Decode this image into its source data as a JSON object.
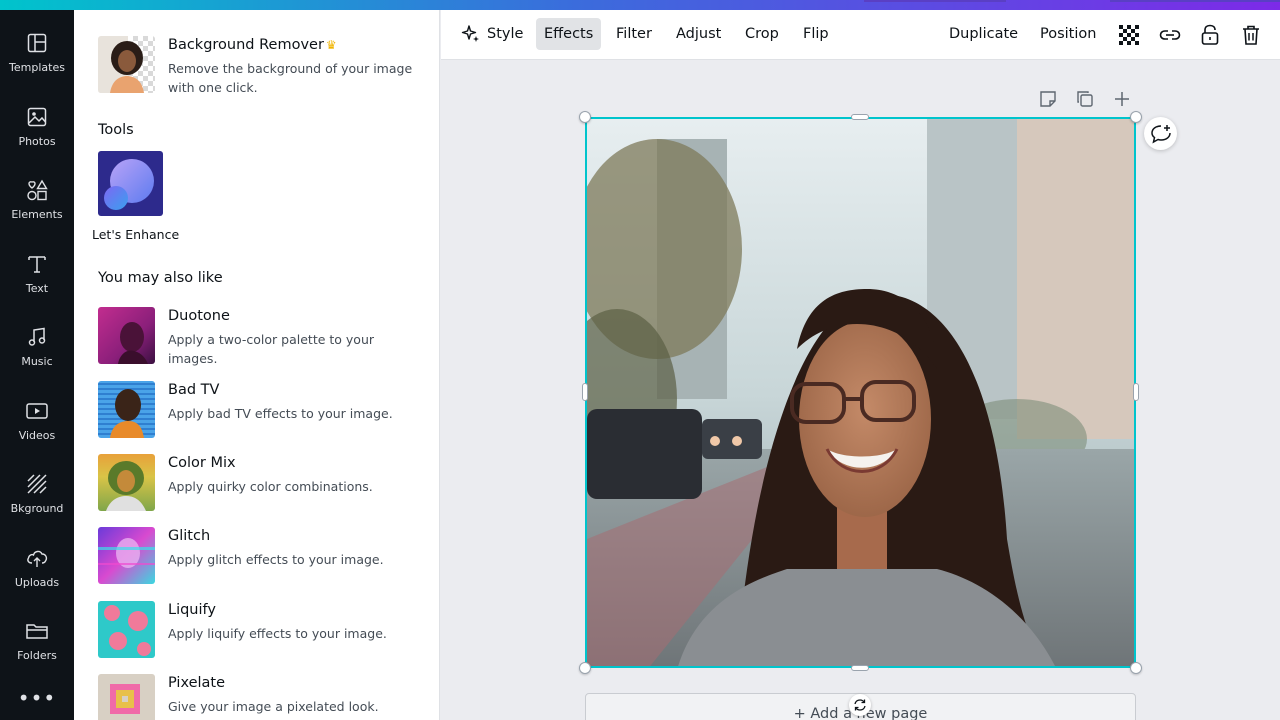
{
  "leftnav": {
    "items": [
      {
        "label": "Templates",
        "icon": "templates-icon"
      },
      {
        "label": "Photos",
        "icon": "photos-icon"
      },
      {
        "label": "Elements",
        "icon": "elements-icon"
      },
      {
        "label": "Text",
        "icon": "text-icon"
      },
      {
        "label": "Music",
        "icon": "music-icon"
      },
      {
        "label": "Videos",
        "icon": "videos-icon"
      },
      {
        "label": "Bkground",
        "icon": "background-icon"
      },
      {
        "label": "Uploads",
        "icon": "uploads-icon"
      },
      {
        "label": "Folders",
        "icon": "folders-icon"
      }
    ],
    "more": "•••"
  },
  "panel": {
    "featured": {
      "name": "Background Remover",
      "crown": "♛",
      "desc": "Remove the background of your image with one click."
    },
    "tools_title": "Tools",
    "tool": {
      "label": "Let's Enhance"
    },
    "also_like_title": "You may also like",
    "apps": [
      {
        "name": "Duotone",
        "desc": "Apply a two-color palette to your images."
      },
      {
        "name": "Bad TV",
        "desc": "Apply bad TV effects to your image."
      },
      {
        "name": "Color Mix",
        "desc": "Apply quirky color combinations."
      },
      {
        "name": "Glitch",
        "desc": "Apply glitch effects to your image."
      },
      {
        "name": "Liquify",
        "desc": "Apply liquify effects to your image."
      },
      {
        "name": "Pixelate",
        "desc": "Give your image a pixelated look."
      }
    ]
  },
  "toolbar": {
    "style": "Style",
    "effects": "Effects",
    "filter": "Filter",
    "adjust": "Adjust",
    "crop": "Crop",
    "flip": "Flip",
    "duplicate": "Duplicate",
    "position": "Position"
  },
  "canvas": {
    "add_page": "+ Add a new page"
  },
  "colors": {
    "accent": "#00c4cc",
    "sidebar": "#0e1318",
    "canvas_bg": "#ebecf0",
    "active_button": "#e1e3e6"
  }
}
